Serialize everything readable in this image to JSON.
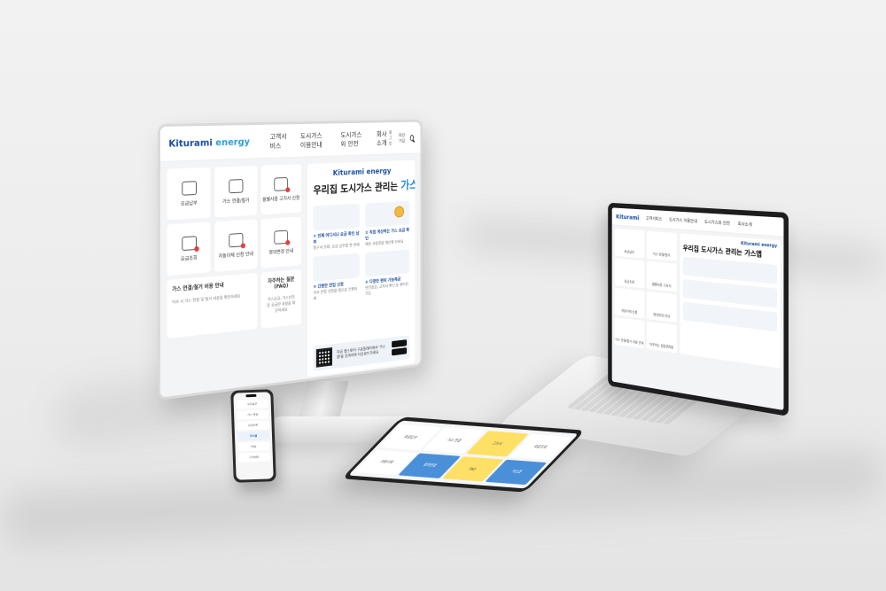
{
  "brand": {
    "name": "Kiturami",
    "suffix": " energy",
    "color": "#1c4fa3",
    "accent": "#1f8ad6"
  },
  "monitor": {
    "menu": [
      "고객서비스",
      "도시가스 이용안내",
      "도시가스와 안전",
      "회사소개"
    ],
    "tools": [
      "로그인",
      "회원가입"
    ],
    "tiles": [
      {
        "label": "요금납부",
        "icon": "bill-icon"
      },
      {
        "label": "가스 연결/철거",
        "icon": "truck-icon"
      },
      {
        "label": "월별사용 고지서 신청",
        "icon": "phone-bill-icon"
      },
      {
        "label": "요금조회",
        "icon": "search-icon"
      },
      {
        "label": "자동이체 신청 안내",
        "icon": "mobile-icon"
      },
      {
        "label": "명의변경 안내",
        "icon": "people-icon"
      }
    ],
    "wide_tiles": [
      {
        "title": "가스 연결/철거 비용 안내",
        "sub": "이사 시 가스 연결 및 철거 비용을 확인하세요"
      },
      {
        "title": "자주하는 질문(FAQ)",
        "sub": "가스요금, 가스안전 등 궁금한 사항을 확인하세요"
      }
    ],
    "banner": {
      "logo": "Kiturami energy",
      "headline": "우리집 도시가스 관리는",
      "headline_hl": "가스앱",
      "features": [
        {
          "title": "① 언제 어디서나 요금 확인 납부",
          "desc": "청구서 조회, 요금 납부를 한 번에"
        },
        {
          "title": "② 직접 계산하는 가스 요금 확인",
          "desc": "예상 사용량을 계산해 보세요"
        },
        {
          "title": "③ 간편한 전입 신청",
          "desc": "이사 전입 신청을 앱으로 간편하게"
        },
        {
          "title": "④ 다양한 편의 기능제공",
          "desc": "안전점검, 고지서 확인 등 편리한 기능"
        }
      ],
      "qr_text": "지금 앱스토어·구글플레이에서 '가스앱'을 검색하여 다운로드하세요"
    }
  },
  "laptop": {
    "menu": [
      "고객서비스",
      "도시가스 이용안내",
      "도시가스와 안전",
      "회사소개"
    ],
    "tiles": [
      "요금납부",
      "가스 연결/철거",
      "요금조회",
      "월별사용 고지서",
      "자동이체 신청",
      "명의변경 안내",
      "가스 연결/철거 비용 안내",
      "자주하는 질문(FAQ)"
    ],
    "brand": "Kiturami energy",
    "headline": "우리집 도시가스 관리는 가스앱"
  },
  "tablet": {
    "cells": [
      "요금납부",
      "가스 연결",
      "고지서",
      "요금조회",
      "자동이체",
      "명의변경",
      "FAQ",
      "가스앱"
    ]
  },
  "phone": {
    "rows": [
      "요금납부",
      "가스 연결",
      "요금조회",
      "가스앱",
      "FAQ",
      "고객센터"
    ]
  }
}
